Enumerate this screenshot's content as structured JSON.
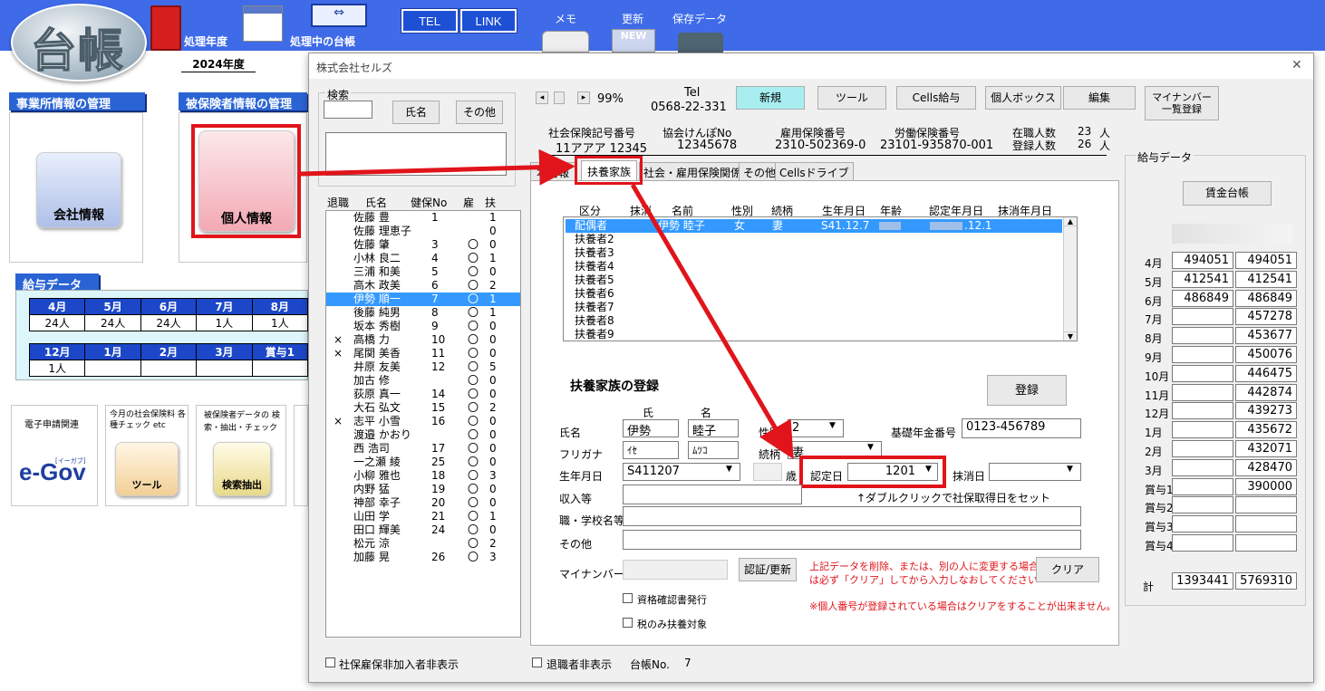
{
  "app": {
    "logo_text": "台帳",
    "year_label": "処理年度",
    "year_value": "2024年度",
    "current_ledger_label": "処理中の台帳",
    "tel_button": "TEL",
    "link_button": "LINK",
    "memo_label": "メモ",
    "update_label": "更新",
    "update_badge": "NEW",
    "save_label": "保存データ"
  },
  "background": {
    "office_header": "事業所情報の管理",
    "insured_header": "被保険者情報の管理",
    "company_info_button": "会社情報",
    "personal_info_button": "個人情報",
    "salary_header": "給与データ",
    "months_row1": [
      "4月",
      "5月",
      "6月",
      "7月",
      "8月"
    ],
    "counts_row1": [
      "24人",
      "24人",
      "24人",
      "1人",
      "1人"
    ],
    "months_row2": [
      "12月",
      "1月",
      "2月",
      "3月",
      "賞与1"
    ],
    "counts_row2": [
      "1人",
      "",
      "",
      "",
      ""
    ],
    "egov_label": "電子申請関連",
    "egov_logo": "e-Gov",
    "egov_sub": "[イーガブ]",
    "tools_label": "今月の社会保険料 各種チェック etc",
    "tools_button": "ツール",
    "extract_label": "被保険者データの 検索・抽出・チェック",
    "extract_button": "検索抽出"
  },
  "dialog": {
    "title": "株式会社セルズ",
    "close_icon_char": "✕",
    "search_label": "検索",
    "name_button": "氏名",
    "other_button": "その他",
    "list_headers": [
      "退職",
      "氏名",
      "健保No",
      "雇",
      "扶"
    ],
    "employees": [
      {
        "ret": "",
        "name": "佐藤 豊",
        "no": "1",
        "emp": "",
        "dep": "1"
      },
      {
        "ret": "",
        "name": "佐藤 理恵子",
        "no": "",
        "emp": "",
        "dep": "0"
      },
      {
        "ret": "",
        "name": "佐藤 肇",
        "no": "3",
        "emp": "〇",
        "dep": "0"
      },
      {
        "ret": "",
        "name": "小林 良二",
        "no": "4",
        "emp": "〇",
        "dep": "1"
      },
      {
        "ret": "",
        "name": "三浦 和美",
        "no": "5",
        "emp": "〇",
        "dep": "0"
      },
      {
        "ret": "",
        "name": "高木 政美",
        "no": "6",
        "emp": "〇",
        "dep": "2"
      },
      {
        "ret": "",
        "name": "伊勢 順一",
        "no": "7",
        "emp": "〇",
        "dep": "1"
      },
      {
        "ret": "",
        "name": "後藤 純男",
        "no": "8",
        "emp": "〇",
        "dep": "1"
      },
      {
        "ret": "",
        "name": "坂本 秀樹",
        "no": "9",
        "emp": "〇",
        "dep": "0"
      },
      {
        "ret": "×",
        "name": "高橋 力",
        "no": "10",
        "emp": "〇",
        "dep": "0"
      },
      {
        "ret": "×",
        "name": "尾関 美香",
        "no": "11",
        "emp": "〇",
        "dep": "0"
      },
      {
        "ret": "",
        "name": "井原 友美",
        "no": "12",
        "emp": "〇",
        "dep": "5"
      },
      {
        "ret": "",
        "name": "加古 修",
        "no": "",
        "emp": "〇",
        "dep": "0"
      },
      {
        "ret": "",
        "name": "荻原 真一",
        "no": "14",
        "emp": "〇",
        "dep": "0"
      },
      {
        "ret": "",
        "name": "大石 弘文",
        "no": "15",
        "emp": "〇",
        "dep": "2"
      },
      {
        "ret": "×",
        "name": "志平 小雪",
        "no": "16",
        "emp": "〇",
        "dep": "0"
      },
      {
        "ret": "",
        "name": "渡邉 かおり",
        "no": "",
        "emp": "〇",
        "dep": "0"
      },
      {
        "ret": "",
        "name": "西 浩司",
        "no": "17",
        "emp": "〇",
        "dep": "0"
      },
      {
        "ret": "",
        "name": "一之瀬 綾",
        "no": "25",
        "emp": "〇",
        "dep": "0"
      },
      {
        "ret": "",
        "name": "小柳 雅也",
        "no": "18",
        "emp": "〇",
        "dep": "3"
      },
      {
        "ret": "",
        "name": "内野 猛",
        "no": "19",
        "emp": "〇",
        "dep": "0"
      },
      {
        "ret": "",
        "name": "神部 幸子",
        "no": "20",
        "emp": "〇",
        "dep": "0"
      },
      {
        "ret": "",
        "name": "山田 学",
        "no": "21",
        "emp": "〇",
        "dep": "1"
      },
      {
        "ret": "",
        "name": "田口 輝美",
        "no": "24",
        "emp": "〇",
        "dep": "0"
      },
      {
        "ret": "",
        "name": "松元 涼",
        "no": "",
        "emp": "〇",
        "dep": "2"
      },
      {
        "ret": "",
        "name": "加藤 晃",
        "no": "26",
        "emp": "〇",
        "dep": "3"
      }
    ],
    "selected_employee": "伊勢 順一",
    "nav_prev": "◂",
    "nav_next": "▸",
    "zoom": "99%",
    "tel_label": "Tel",
    "tel_value": "0568-22-331",
    "new_button": "新規",
    "tool_button": "ツール",
    "cells_salary_button": "Cells給与",
    "personal_box_button": "個人ボックス",
    "edit_button": "編集",
    "mynumber_button": "マイナンバー 一覧登録",
    "info": {
      "social_no_label": "社会保険記号番号",
      "social_no": "11アアア 12345",
      "kenpo_label": "協会けんぽNo",
      "kenpo_no": "12345678",
      "koyo_label": "雇用保険番号",
      "koyo_no": "2310-502369-0",
      "rodo_label": "労働保険番号",
      "rodo_no": "23101-935870-001",
      "active_label": "在職人数",
      "active_count": "23",
      "registered_label": "登録人数",
      "registered_count": "26",
      "unit": "人"
    },
    "tabs": [
      "本情報",
      "扶養家族",
      "社会・雇用保険関係",
      "その他",
      "Cellsドライブ"
    ],
    "active_tab": "扶養家族",
    "dep_headers": [
      "区分",
      "抹消",
      "名前",
      "性別",
      "続柄",
      "生年月日",
      "年齢",
      "認定年月日",
      "抹消年月日"
    ],
    "dependents": [
      {
        "kubun": "配偶者",
        "name": "伊勢 睦子",
        "sex": "女",
        "rel": "妻",
        "birth": "S41.12.7",
        "nintei": ".12.1"
      },
      {
        "kubun": "扶養者2"
      },
      {
        "kubun": "扶養者3"
      },
      {
        "kubun": "扶養者4"
      },
      {
        "kubun": "扶養者5"
      },
      {
        "kubun": "扶養者6"
      },
      {
        "kubun": "扶養者7"
      },
      {
        "kubun": "扶養者8"
      },
      {
        "kubun": "扶養者9"
      }
    ],
    "form": {
      "section_title": "扶養家族の登録",
      "register_button": "登録",
      "sei_header": "氏",
      "mei_header": "名",
      "name_label": "氏名",
      "sei": "伊勢",
      "mei": "睦子",
      "furigana_label": "フリガナ",
      "sei_kana": "ｲｾ",
      "mei_kana": "ﾑﾂｺ",
      "sex_label": "性別",
      "sex_value": "2",
      "relation_label": "続柄",
      "relation_value": "妻",
      "pension_label": "基礎年金番号",
      "pension_value": "0123-456789",
      "birth_label": "生年月日",
      "birth_value": "S411207",
      "age_suffix": "歳",
      "nintei_label": "認定日",
      "nintei_value": "1201",
      "delete_label": "抹消日",
      "income_label": "収入等",
      "hint": "↑ダブルクリックで社保取得日をセット",
      "job_label": "職・学校名等",
      "other_label": "その他",
      "mynumber_label": "マイナンバー",
      "auth_button": "認証/更新",
      "warning1": "上記データを削除、または、別の人に変更する場合",
      "warning2": "は必ず「クリア」してから入力しなおしてください⇒⇒",
      "clear_button": "クリア",
      "warning3": "※個人番号が登録されている場合はクリアをすることが出来ません。",
      "chk_cert": "資格確認書発行",
      "chk_tax": "税のみ扶養対象"
    },
    "salary": {
      "title": "給与データ",
      "ledger_button": "賃金台帳",
      "rows": [
        {
          "m": "4月",
          "a": "494051",
          "b": "494051"
        },
        {
          "m": "5月",
          "a": "412541",
          "b": "412541"
        },
        {
          "m": "6月",
          "a": "486849",
          "b": "486849"
        },
        {
          "m": "7月",
          "a": "",
          "b": "457278"
        },
        {
          "m": "8月",
          "a": "",
          "b": "453677"
        },
        {
          "m": "9月",
          "a": "",
          "b": "450076"
        },
        {
          "m": "10月",
          "a": "",
          "b": "446475"
        },
        {
          "m": "11月",
          "a": "",
          "b": "442874"
        },
        {
          "m": "12月",
          "a": "",
          "b": "439273"
        },
        {
          "m": "1月",
          "a": "",
          "b": "435672"
        },
        {
          "m": "2月",
          "a": "",
          "b": "432071"
        },
        {
          "m": "3月",
          "a": "",
          "b": "428470"
        },
        {
          "m": "賞与1",
          "a": "",
          "b": "390000"
        },
        {
          "m": "賞与2",
          "a": "",
          "b": ""
        },
        {
          "m": "賞与3",
          "a": "",
          "b": ""
        },
        {
          "m": "賞与4",
          "a": "",
          "b": ""
        }
      ],
      "total_label": "計",
      "total_a": "1393441",
      "total_b": "5769310"
    },
    "footer": {
      "hide_nonmember": "社保雇保非加入者非表示",
      "hide_retired": "退職者非表示",
      "ledger_no_label": "台帳No.",
      "ledger_no": "7"
    }
  },
  "colors": {
    "accent_red": "#e0141a",
    "selection": "#3399ff",
    "header_blue": "#3f6be9",
    "new_button": "#a8eef0"
  }
}
